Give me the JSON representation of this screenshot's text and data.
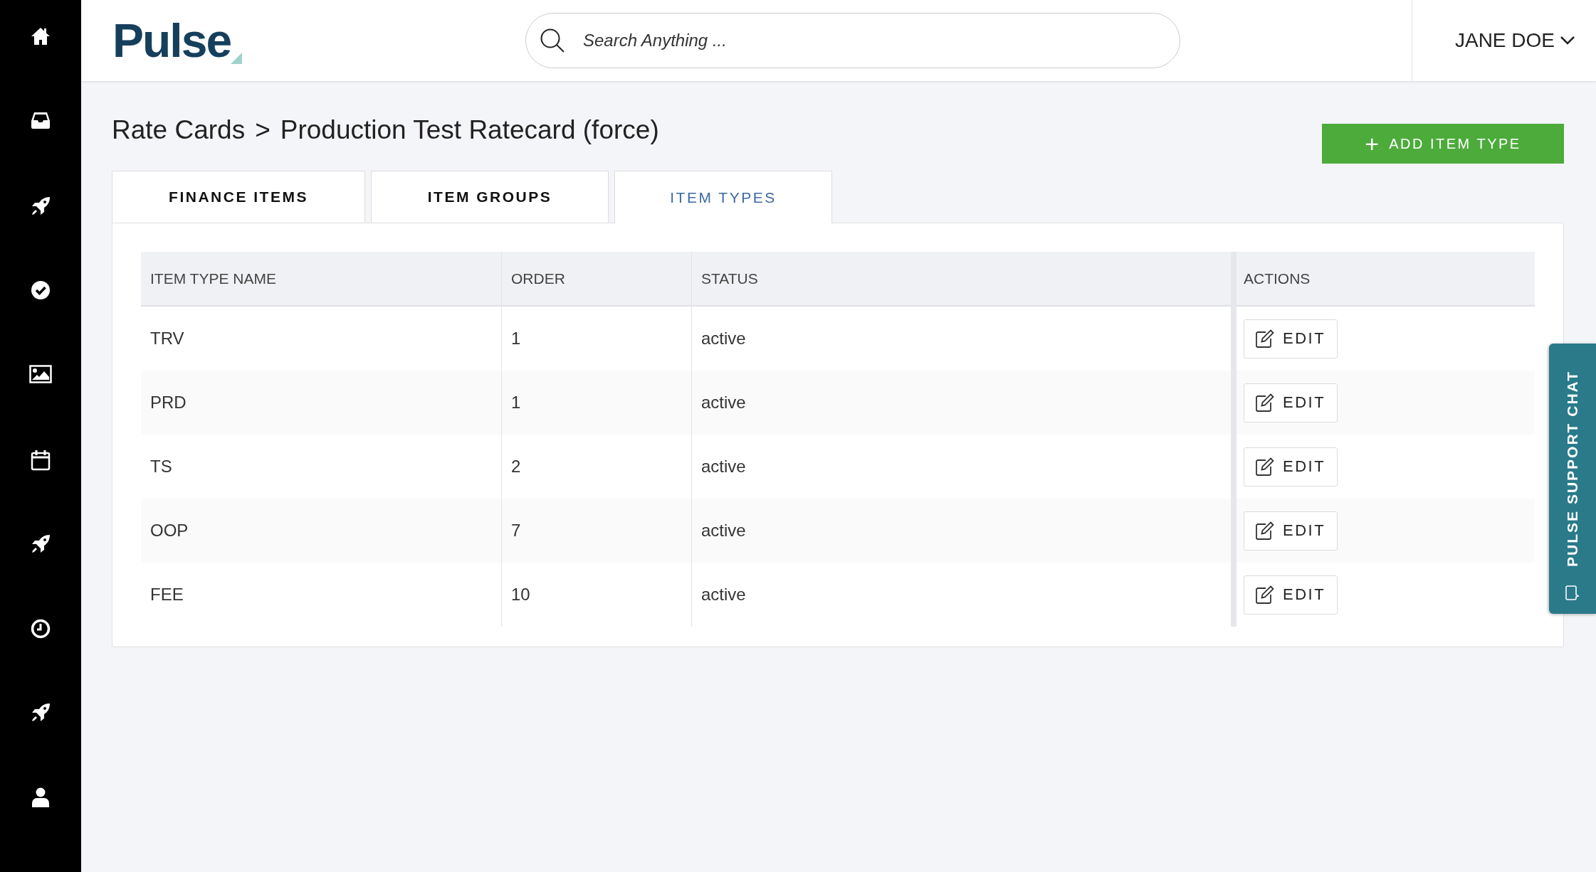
{
  "sidebar": {
    "items": [
      {
        "kind": "home"
      },
      {
        "kind": "inbox"
      },
      {
        "kind": "rocket"
      },
      {
        "kind": "check"
      },
      {
        "kind": "image"
      },
      {
        "kind": "calendar"
      },
      {
        "kind": "rocket"
      },
      {
        "kind": "clock"
      },
      {
        "kind": "rocket"
      },
      {
        "kind": "user"
      }
    ]
  },
  "header": {
    "logo": "Pulse",
    "search": {
      "placeholder": "Search Anything ..."
    },
    "user": "JANE DOE"
  },
  "breadcrumb": [
    {
      "label": "Rate Cards"
    },
    {
      "label": ">"
    },
    {
      "label": "Production Test Ratecard (force)"
    }
  ],
  "add_button": {
    "icon": "+",
    "label": "ADD ITEM TYPE"
  },
  "tabs": [
    {
      "label": "FINANCE ITEMS",
      "selected": false
    },
    {
      "label": "ITEM GROUPS",
      "selected": false
    },
    {
      "label": "ITEM TYPES",
      "selected": true
    }
  ],
  "table": {
    "columns": [
      "ITEM TYPE NAME",
      "ORDER",
      "STATUS",
      "ACTIONS"
    ],
    "rows": [
      {
        "name": "TRV",
        "order": "1",
        "status": "active",
        "action": "EDIT"
      },
      {
        "name": "PRD",
        "order": "1",
        "status": "active",
        "action": "EDIT"
      },
      {
        "name": "TS",
        "order": "2",
        "status": "active",
        "action": "EDIT"
      },
      {
        "name": "OOP",
        "order": "7",
        "status": "active",
        "action": "EDIT"
      },
      {
        "name": "FEE",
        "order": "10",
        "status": "active",
        "action": "EDIT"
      }
    ]
  },
  "support_chat": {
    "label": "PULSE SUPPORT CHAT"
  }
}
